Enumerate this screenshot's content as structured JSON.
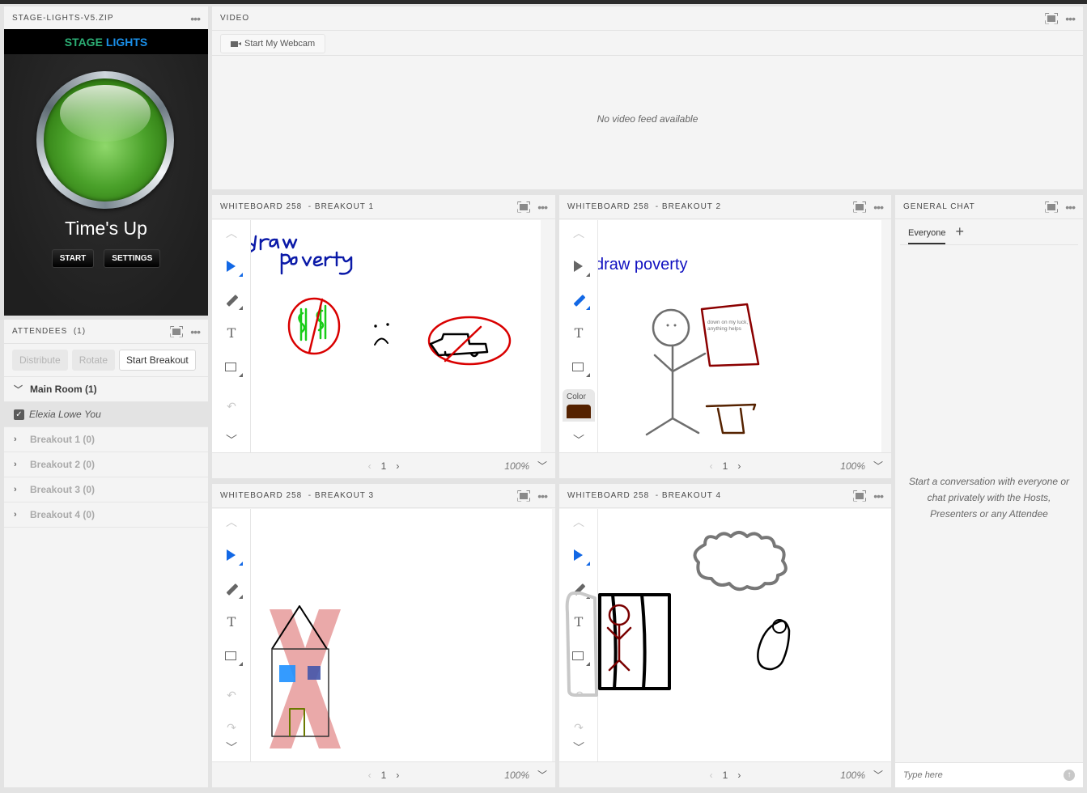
{
  "stage": {
    "pod_title": "STAGE-LIGHTS-V5.ZIP",
    "brand_part1": "STAGE",
    "brand_part2": "LIGHTS",
    "status": "Time's Up",
    "light_color": "#4aa12a",
    "start_label": "START",
    "settings_label": "SETTINGS"
  },
  "attendees": {
    "pod_title": "ATTENDEES  (1)",
    "buttons": {
      "distribute": "Distribute",
      "rotate": "Rotate",
      "start_breakout": "Start Breakout"
    },
    "rooms": [
      {
        "label": "Main Room (1)",
        "expanded": true
      },
      {
        "label": "Breakout 1 (0)",
        "expanded": false
      },
      {
        "label": "Breakout 2 (0)",
        "expanded": false
      },
      {
        "label": "Breakout 3 (0)",
        "expanded": false
      },
      {
        "label": "Breakout 4 (0)",
        "expanded": false
      }
    ],
    "user": {
      "name": "Elexia Lowe",
      "tag": "You",
      "checked": true
    }
  },
  "video": {
    "pod_title": "VIDEO",
    "webcam_label": "Start My Webcam",
    "empty_message": "No video feed available"
  },
  "whiteboards": [
    {
      "title": "WHITEBOARD 258  - BREAKOUT 1",
      "page": "1",
      "zoom": "100%",
      "handwriting": "draw poverty"
    },
    {
      "title": "WHITEBOARD 258  - BREAKOUT 2",
      "page": "1",
      "zoom": "100%",
      "text": "draw poverty",
      "sign_text": "down on my luck, anything helps",
      "color_label": "Color",
      "selected_color": "#552200"
    },
    {
      "title": "WHITEBOARD 258  - BREAKOUT 3",
      "page": "1",
      "zoom": "100%"
    },
    {
      "title": "WHITEBOARD 258  - BREAKOUT 4",
      "page": "1",
      "zoom": "100%"
    }
  ],
  "chat": {
    "pod_title": "GENERAL CHAT",
    "tab_label": "Everyone",
    "empty_message": "Start a conversation with everyone or chat privately with the Hosts, Presenters or any Attendee",
    "input_placeholder": "Type here"
  },
  "icons": {
    "more": "•••",
    "chevron_down": "⌄",
    "chevron_right": "›",
    "chevron_left": "‹",
    "check": "✓",
    "plus": "+",
    "send": "↑",
    "undo": "↶",
    "redo": "↷",
    "up": "︿",
    "down": "﹀"
  }
}
